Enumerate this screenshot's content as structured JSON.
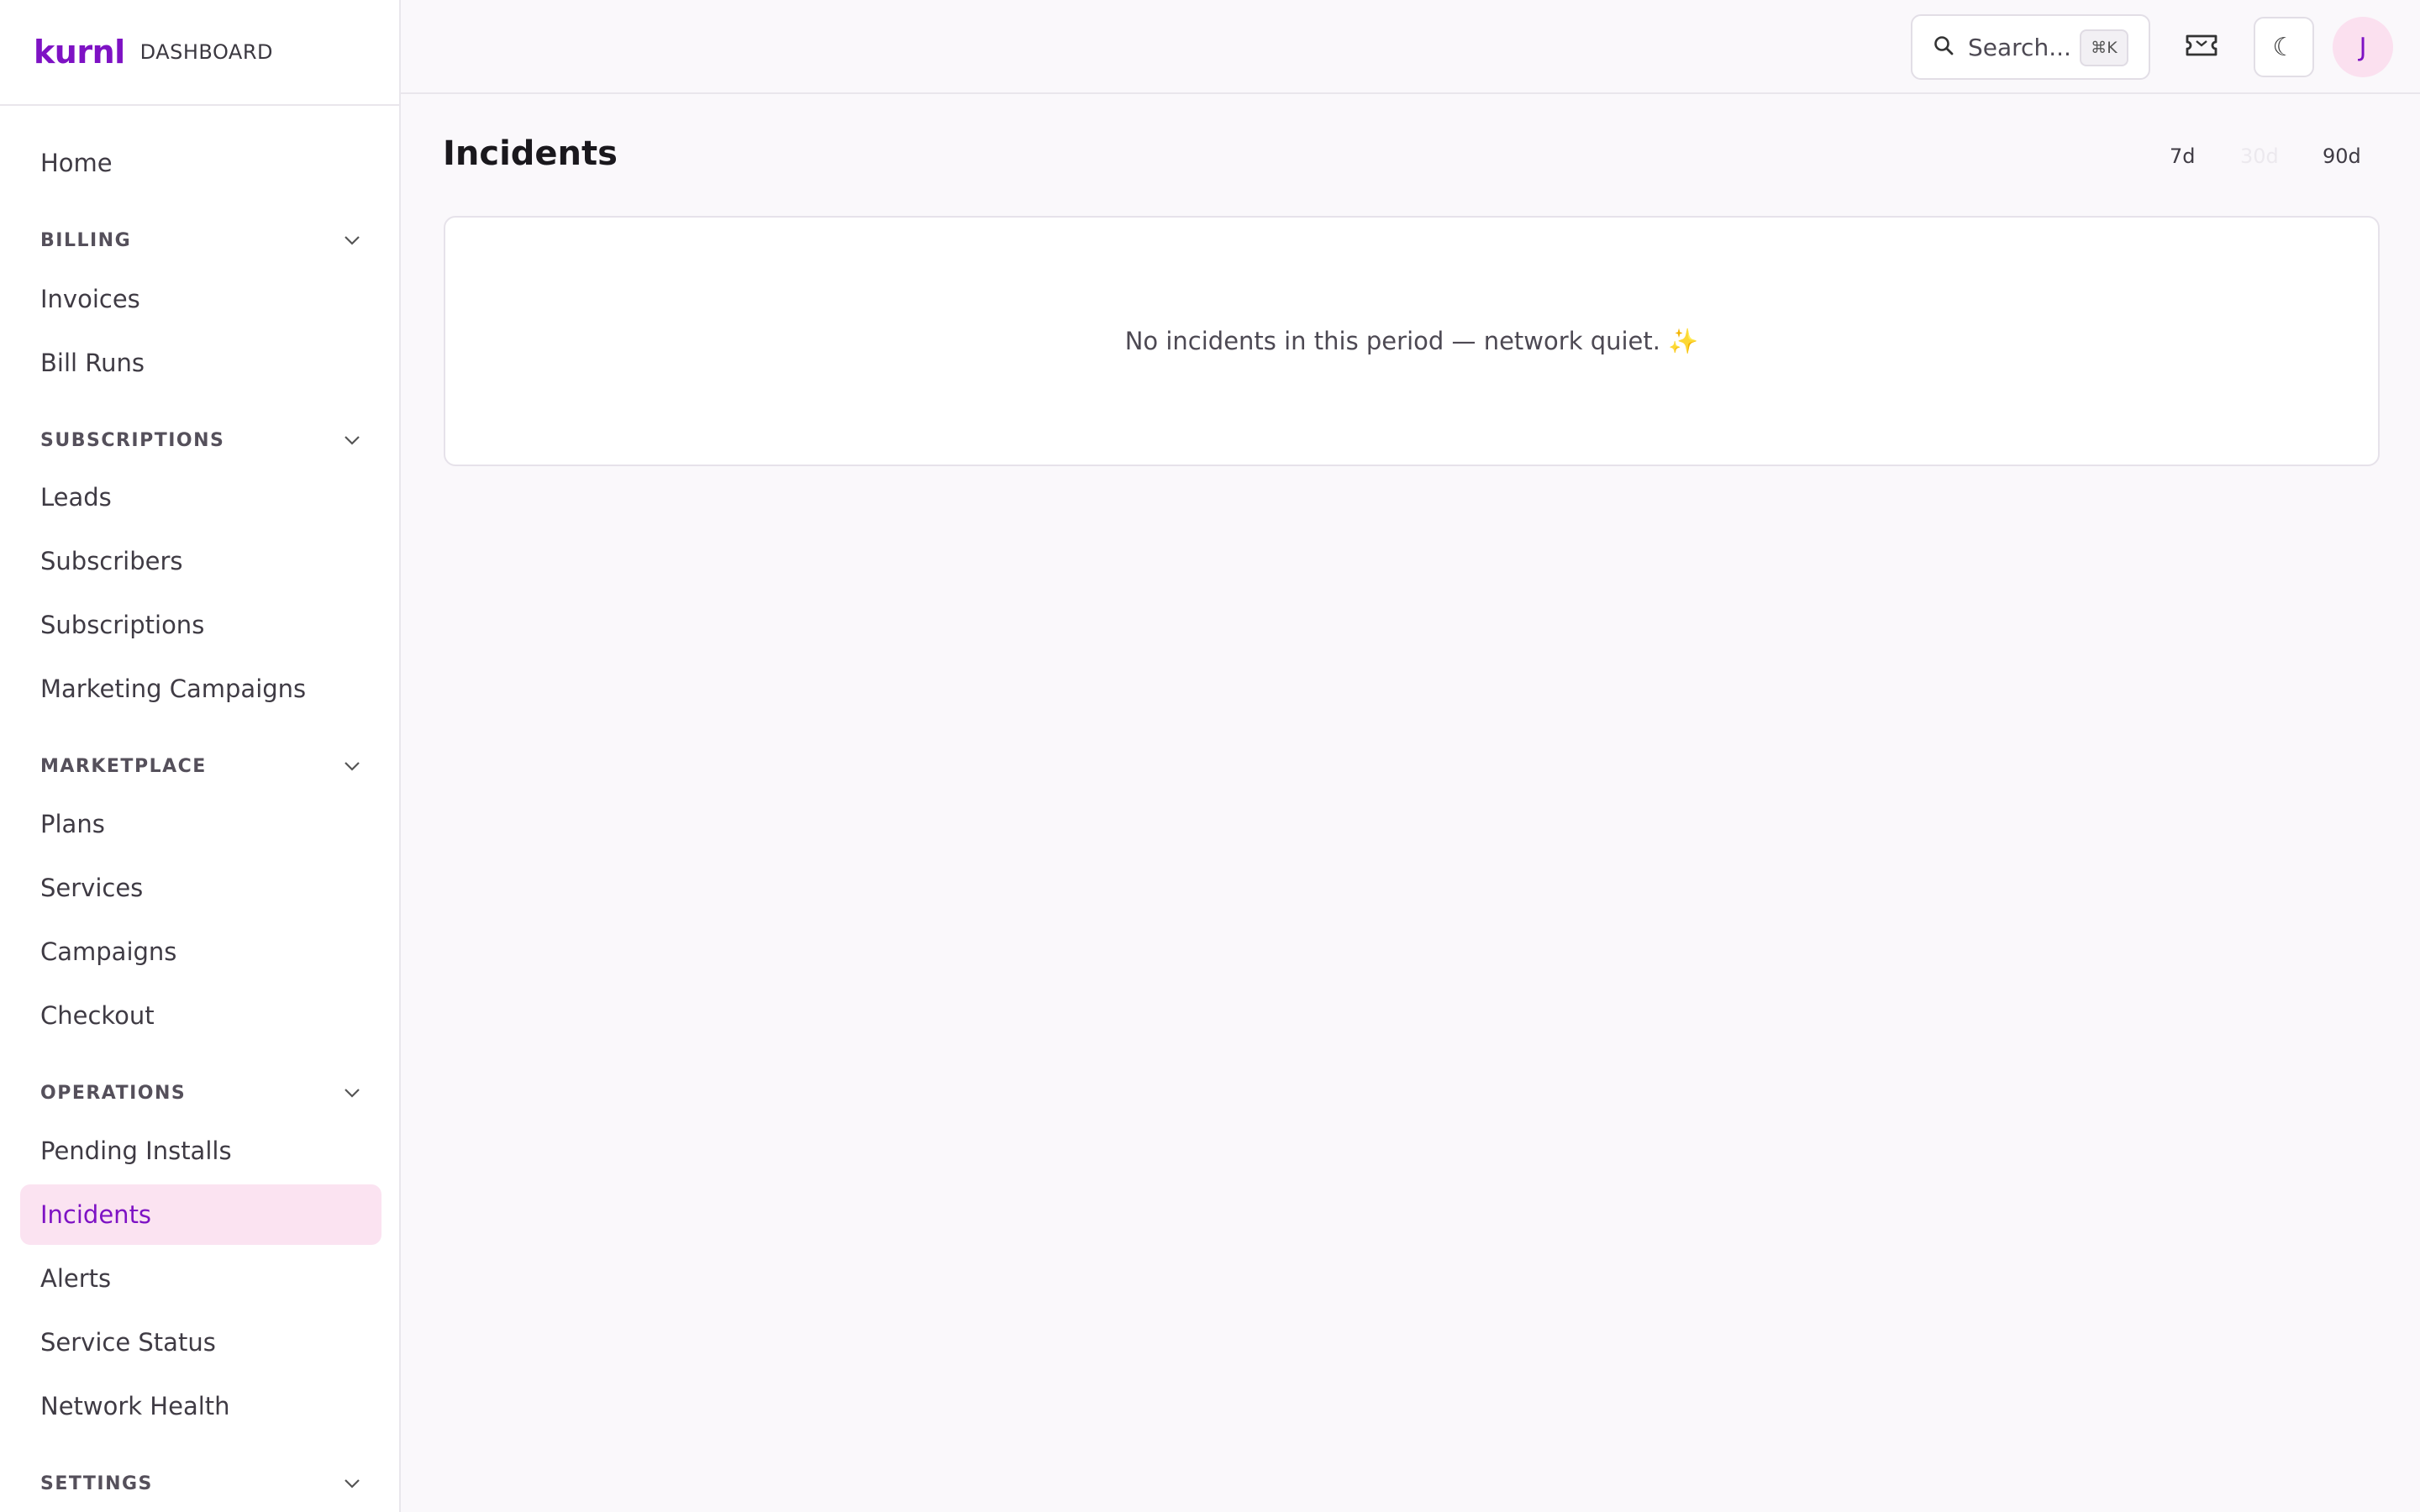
{
  "brand": {
    "logo": "kurnl",
    "subtitle": "DASHBOARD"
  },
  "sidebar": {
    "home": "Home",
    "billing": {
      "label": "BILLING",
      "items": [
        "Invoices",
        "Bill Runs"
      ]
    },
    "subscriptions": {
      "label": "SUBSCRIPTIONS",
      "items": [
        "Leads",
        "Subscribers",
        "Subscriptions",
        "Marketing Campaigns"
      ]
    },
    "marketplace": {
      "label": "MARKETPLACE",
      "items": [
        "Plans",
        "Services",
        "Campaigns",
        "Checkout"
      ]
    },
    "operations": {
      "label": "OPERATIONS",
      "items": [
        "Pending Installs",
        "Incidents",
        "Alerts",
        "Service Status",
        "Network Health"
      ]
    },
    "settings": {
      "label": "SETTINGS"
    },
    "active_item": "Incidents"
  },
  "topbar": {
    "search_placeholder": "Search...",
    "search_shortcut": "⌘K",
    "avatar_initial": "J",
    "icons": [
      "search-icon",
      "ticket-icon",
      "moon-icon"
    ]
  },
  "main": {
    "title": "Incidents",
    "ranges": [
      "7d",
      "30d",
      "90d"
    ],
    "empty_message": "No incidents in this period — network quiet. ✨"
  },
  "colors": {
    "accent": "#7e12c4",
    "active_bg": "#fbe3f1",
    "page_bg": "#faf8fb"
  }
}
